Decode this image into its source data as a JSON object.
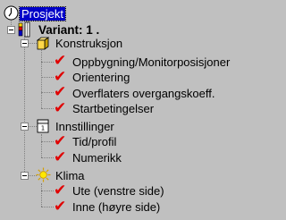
{
  "tree": {
    "root": {
      "label": "Prosjekt",
      "icon": "project-clock-icon"
    },
    "variant": {
      "label": "Variant: 1 .",
      "icon": "variant-building-icon"
    },
    "groups": [
      {
        "label": "Konstruksjon",
        "icon": "construction-box-icon",
        "items": [
          {
            "label": "Oppbygning/Monitorposisjoner",
            "icon": "checkmark-icon"
          },
          {
            "label": "Orientering",
            "icon": "checkmark-icon"
          },
          {
            "label": "Overflaters overgangskoeff.",
            "icon": "checkmark-icon"
          },
          {
            "label": "Startbetingelser",
            "icon": "checkmark-icon"
          }
        ]
      },
      {
        "label": "Innstillinger",
        "icon": "settings-calendar-icon",
        "items": [
          {
            "label": "Tid/profil",
            "icon": "checkmark-icon"
          },
          {
            "label": "Numerikk",
            "icon": "checkmark-icon"
          }
        ]
      },
      {
        "label": "Klima",
        "icon": "climate-sun-icon",
        "items": [
          {
            "label": "Ute (venstre side)",
            "icon": "checkmark-icon"
          },
          {
            "label": "Inne (høyre side)",
            "icon": "checkmark-icon"
          }
        ]
      }
    ]
  },
  "colors": {
    "selection": "#0000c8",
    "check": "#e00000",
    "background": "#c0c0c0"
  }
}
